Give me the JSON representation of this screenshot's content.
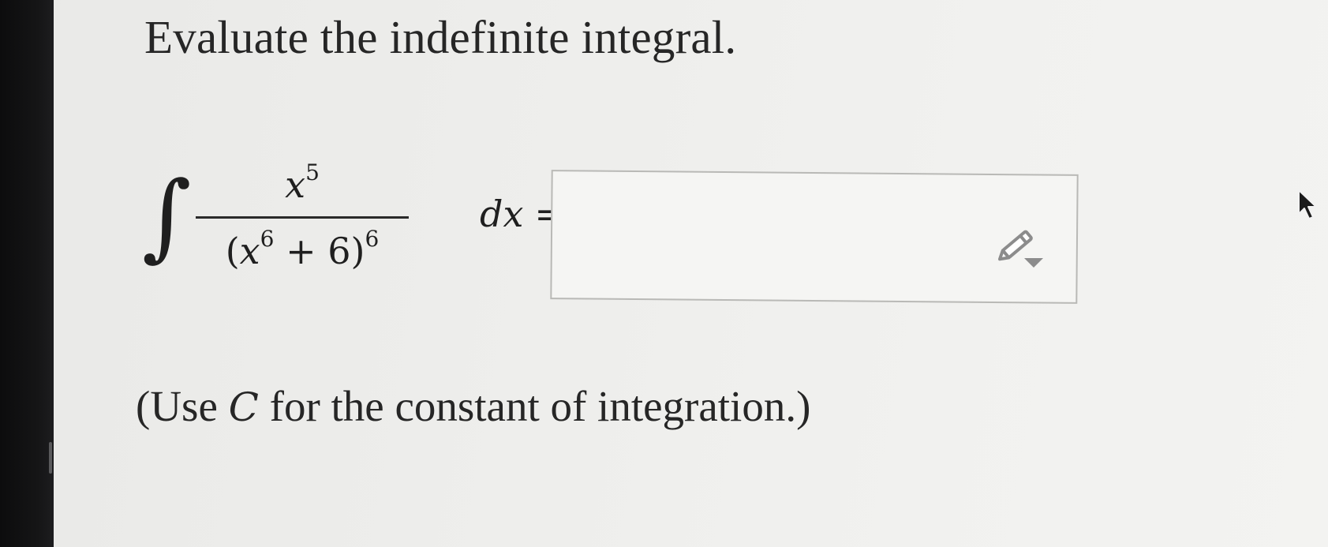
{
  "problem": {
    "title": "Evaluate the indefinite integral.",
    "integrand": {
      "numerator_base": "x",
      "numerator_exponent": "5",
      "denominator_open": "(",
      "denominator_base": "x",
      "denominator_inner_exponent": "6",
      "denominator_plus": " + 6)",
      "denominator_outer_exponent": "6"
    },
    "integral_symbol": "∫",
    "differential": "dx",
    "equals": "=",
    "answer_value": "",
    "hint_prefix": "(Use ",
    "hint_constant": "C",
    "hint_suffix": " for the constant of integration.)"
  },
  "icons": {
    "answer_tool": "pencil-dropdown-icon",
    "pointer": "mouse-cursor-icon"
  },
  "colors": {
    "page_background": "#ededeb",
    "text": "#262626",
    "input_border": "#b9b9b6",
    "icon_gray": "#8c8c8c"
  }
}
